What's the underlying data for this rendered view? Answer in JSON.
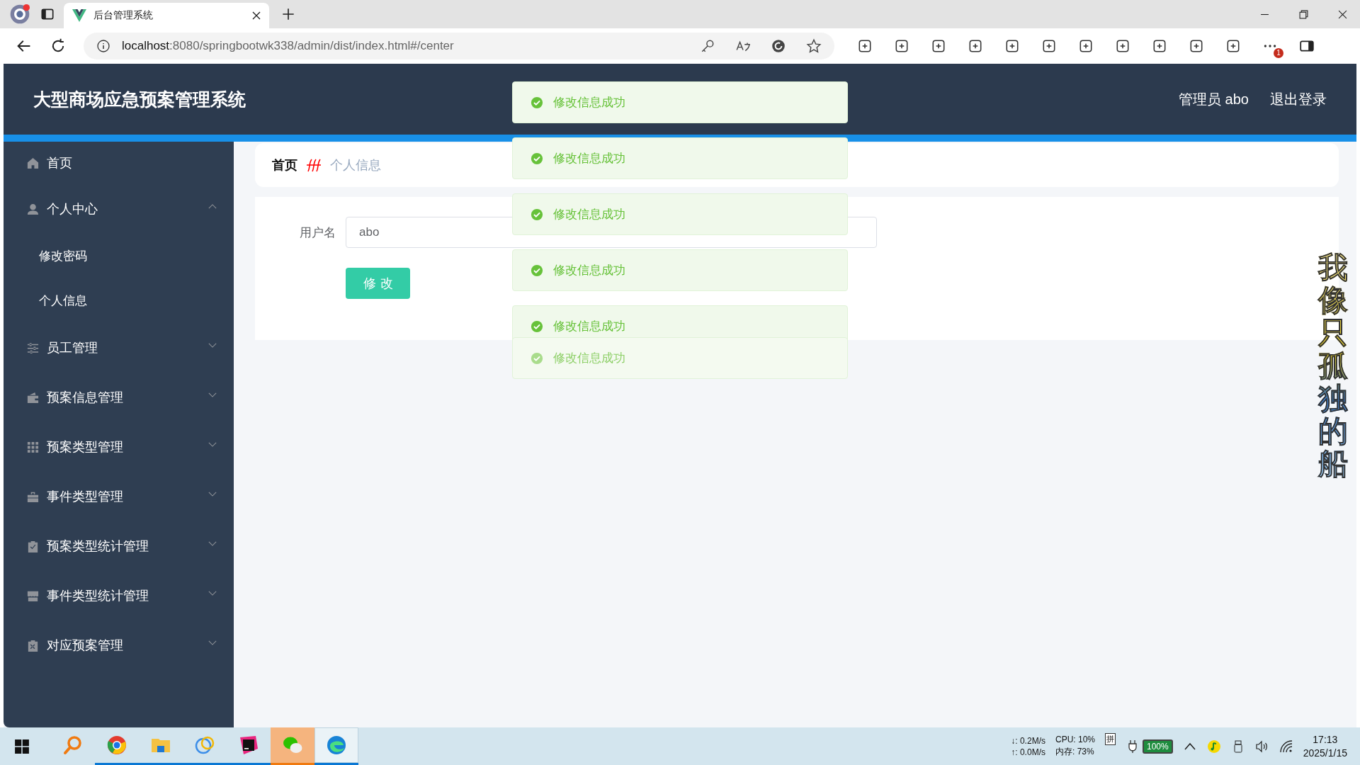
{
  "browser": {
    "tabs": [
      {
        "title": "后台管理系统",
        "selected": true
      }
    ],
    "url": {
      "host": "localhost",
      "path": ":8080/springbootwk338/admin/dist/index.html#/center"
    },
    "notification_count": "1"
  },
  "header": {
    "title": "大型商场应急预案管理系统",
    "user": "管理员 abo",
    "logout": "退出登录"
  },
  "sidebar": {
    "items": [
      {
        "label": "首页"
      },
      {
        "label": "个人中心",
        "expanded": true,
        "children": [
          {
            "label": "修改密码"
          },
          {
            "label": "个人信息"
          }
        ]
      },
      {
        "label": "员工管理",
        "expanded": false
      },
      {
        "label": "预案信息管理",
        "expanded": false
      },
      {
        "label": "预案类型管理",
        "expanded": false
      },
      {
        "label": "事件类型管理",
        "expanded": false
      },
      {
        "label": "预案类型统计管理",
        "expanded": false
      },
      {
        "label": "事件类型统计管理",
        "expanded": false
      },
      {
        "label": "对应预案管理",
        "expanded": false
      }
    ]
  },
  "breadcrumb": [
    {
      "label": "首页",
      "current": false
    },
    {
      "label": "个人信息",
      "current": true
    }
  ],
  "form": {
    "fields": [
      {
        "label": "用户名",
        "value": "abo"
      }
    ],
    "submit": "修改"
  },
  "toasts": [
    {
      "message": "修改信息成功",
      "fading": false
    },
    {
      "message": "修改信息成功",
      "fading": false
    },
    {
      "message": "修改信息成功",
      "fading": false
    },
    {
      "message": "修改信息成功",
      "fading": false
    },
    {
      "message": "修改信息成功",
      "fading": false
    },
    {
      "message": "修改信息成功",
      "fading": true
    }
  ],
  "lyric": "我像只孤独的船",
  "taskbar": {
    "apps": [
      {
        "running": false,
        "attention": false,
        "selected": false
      },
      {
        "running": true,
        "attention": false,
        "selected": false
      },
      {
        "running": true,
        "attention": false,
        "selected": false
      },
      {
        "running": true,
        "attention": false,
        "selected": false
      },
      {
        "running": true,
        "attention": false,
        "selected": false
      },
      {
        "running": true,
        "attention": true,
        "selected": false
      },
      {
        "running": true,
        "attention": false,
        "selected": true
      }
    ],
    "net_down": "↓: 0.2M/s",
    "net_up": "↑: 0.0M/s",
    "cpu": "CPU: 10%",
    "memory": "内存: 73%",
    "ime": "拼",
    "battery": "100%",
    "time": "17:13",
    "date": "2025/1/15"
  }
}
